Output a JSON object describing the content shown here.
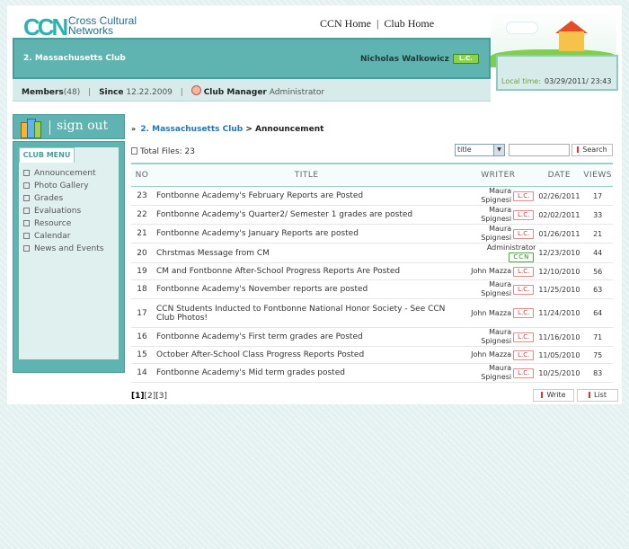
{
  "brand": {
    "mark": "CCN",
    "name_line1": "Cross Cultural",
    "name_line2": "Networks"
  },
  "topnav": {
    "ccn_home": "CCN Home",
    "club_home": "Club Home"
  },
  "banner": {
    "club_name": "2. Massachusetts Club",
    "user_name": "Nicholas Walkowicz",
    "user_badge": "L.C."
  },
  "memberbar": {
    "members_label": "Members",
    "members_count": "(48)",
    "since_label": "Since",
    "since_value": "12.22.2009",
    "manager_label": "Club Manager",
    "manager_value": "Administrator"
  },
  "localtime": {
    "label": "Local time:",
    "value": "03/29/2011/ 23:43"
  },
  "signout": {
    "label": "sign out"
  },
  "club_menu": {
    "title": "CLUB MENU",
    "items": [
      {
        "label": "Announcement",
        "icon": "megaphone-icon"
      },
      {
        "label": "Photo Gallery",
        "icon": "camera-icon"
      },
      {
        "label": "Grades",
        "icon": "grid-icon"
      },
      {
        "label": "Evaluations",
        "icon": "clipboard-icon"
      },
      {
        "label": "Resource",
        "icon": "folder-icon"
      },
      {
        "label": "Calendar",
        "icon": "calendar-icon"
      },
      {
        "label": "News and Events",
        "icon": "news-icon"
      }
    ]
  },
  "breadcrumb": {
    "arrow": "»",
    "club": "2. Massachusetts Club",
    "separator": ">",
    "page": "Announcement"
  },
  "files": {
    "label": "Total Files:",
    "count": "23"
  },
  "search": {
    "field_option": "title",
    "button": "Search"
  },
  "table": {
    "headers": {
      "no": "NO",
      "title": "TITLE",
      "writer": "WRITER",
      "date": "DATE",
      "views": "VIEWS"
    },
    "rows": [
      {
        "no": "23",
        "title": "Fontbonne Academy's February Reports are Posted",
        "writer1": "Maura",
        "writer2": "Spignesi",
        "badge": "L.C.",
        "date": "02/26/2011",
        "views": "17"
      },
      {
        "no": "22",
        "title": "Fontbonne Academy's Quarter2/ Semester 1 grades are posted",
        "writer1": "Maura",
        "writer2": "Spignesi",
        "badge": "L.C.",
        "date": "02/02/2011",
        "views": "33"
      },
      {
        "no": "21",
        "title": "Fontbonne Academy's January Reports are posted",
        "writer1": "Maura",
        "writer2": "Spignesi",
        "badge": "L.C.",
        "date": "01/26/2011",
        "views": "21"
      },
      {
        "no": "20",
        "title": "Chrstmas Message from CM",
        "writer1": "",
        "writer2": "Administrator",
        "badge": "CCN",
        "date": "12/23/2010",
        "views": "44"
      },
      {
        "no": "19",
        "title": "CM and Fontbonne After-School Progress Reports Are Posted",
        "writer1": "",
        "writer2": "John Mazza",
        "badge": "L.C.",
        "date": "12/10/2010",
        "views": "56"
      },
      {
        "no": "18",
        "title": "Fontbonne Academy's November reports are posted",
        "writer1": "Maura",
        "writer2": "Spignesi",
        "badge": "L.C.",
        "date": "11/25/2010",
        "views": "63"
      },
      {
        "no": "17",
        "title": "CCN Students Inducted to Fontbonne National Honor Society - See CCN Club Photos!",
        "writer1": "",
        "writer2": "John Mazza",
        "badge": "L.C.",
        "date": "11/24/2010",
        "views": "64"
      },
      {
        "no": "16",
        "title": "Fontbonne Academy's First term grades are Posted",
        "writer1": "Maura",
        "writer2": "Spignesi",
        "badge": "L.C.",
        "date": "11/16/2010",
        "views": "71"
      },
      {
        "no": "15",
        "title": "October After-School Class Progress Reports Posted",
        "writer1": "",
        "writer2": "John Mazza",
        "badge": "L.C.",
        "date": "11/05/2010",
        "views": "75"
      },
      {
        "no": "14",
        "title": "Fontbonne Academy's Mid term grades posted",
        "writer1": "Maura",
        "writer2": "Spignesi",
        "badge": "L.C.",
        "date": "10/25/2010",
        "views": "83"
      }
    ]
  },
  "pager": {
    "current": "[1]",
    "pages": [
      "[2]",
      "[3]"
    ]
  },
  "actions": {
    "write": "Write",
    "list": "List"
  },
  "colors": {
    "teal": "#5fb3b0",
    "link_blue": "#2277bb",
    "lc_red": "#d13a3a",
    "ccn_green": "#2c8a2c"
  }
}
